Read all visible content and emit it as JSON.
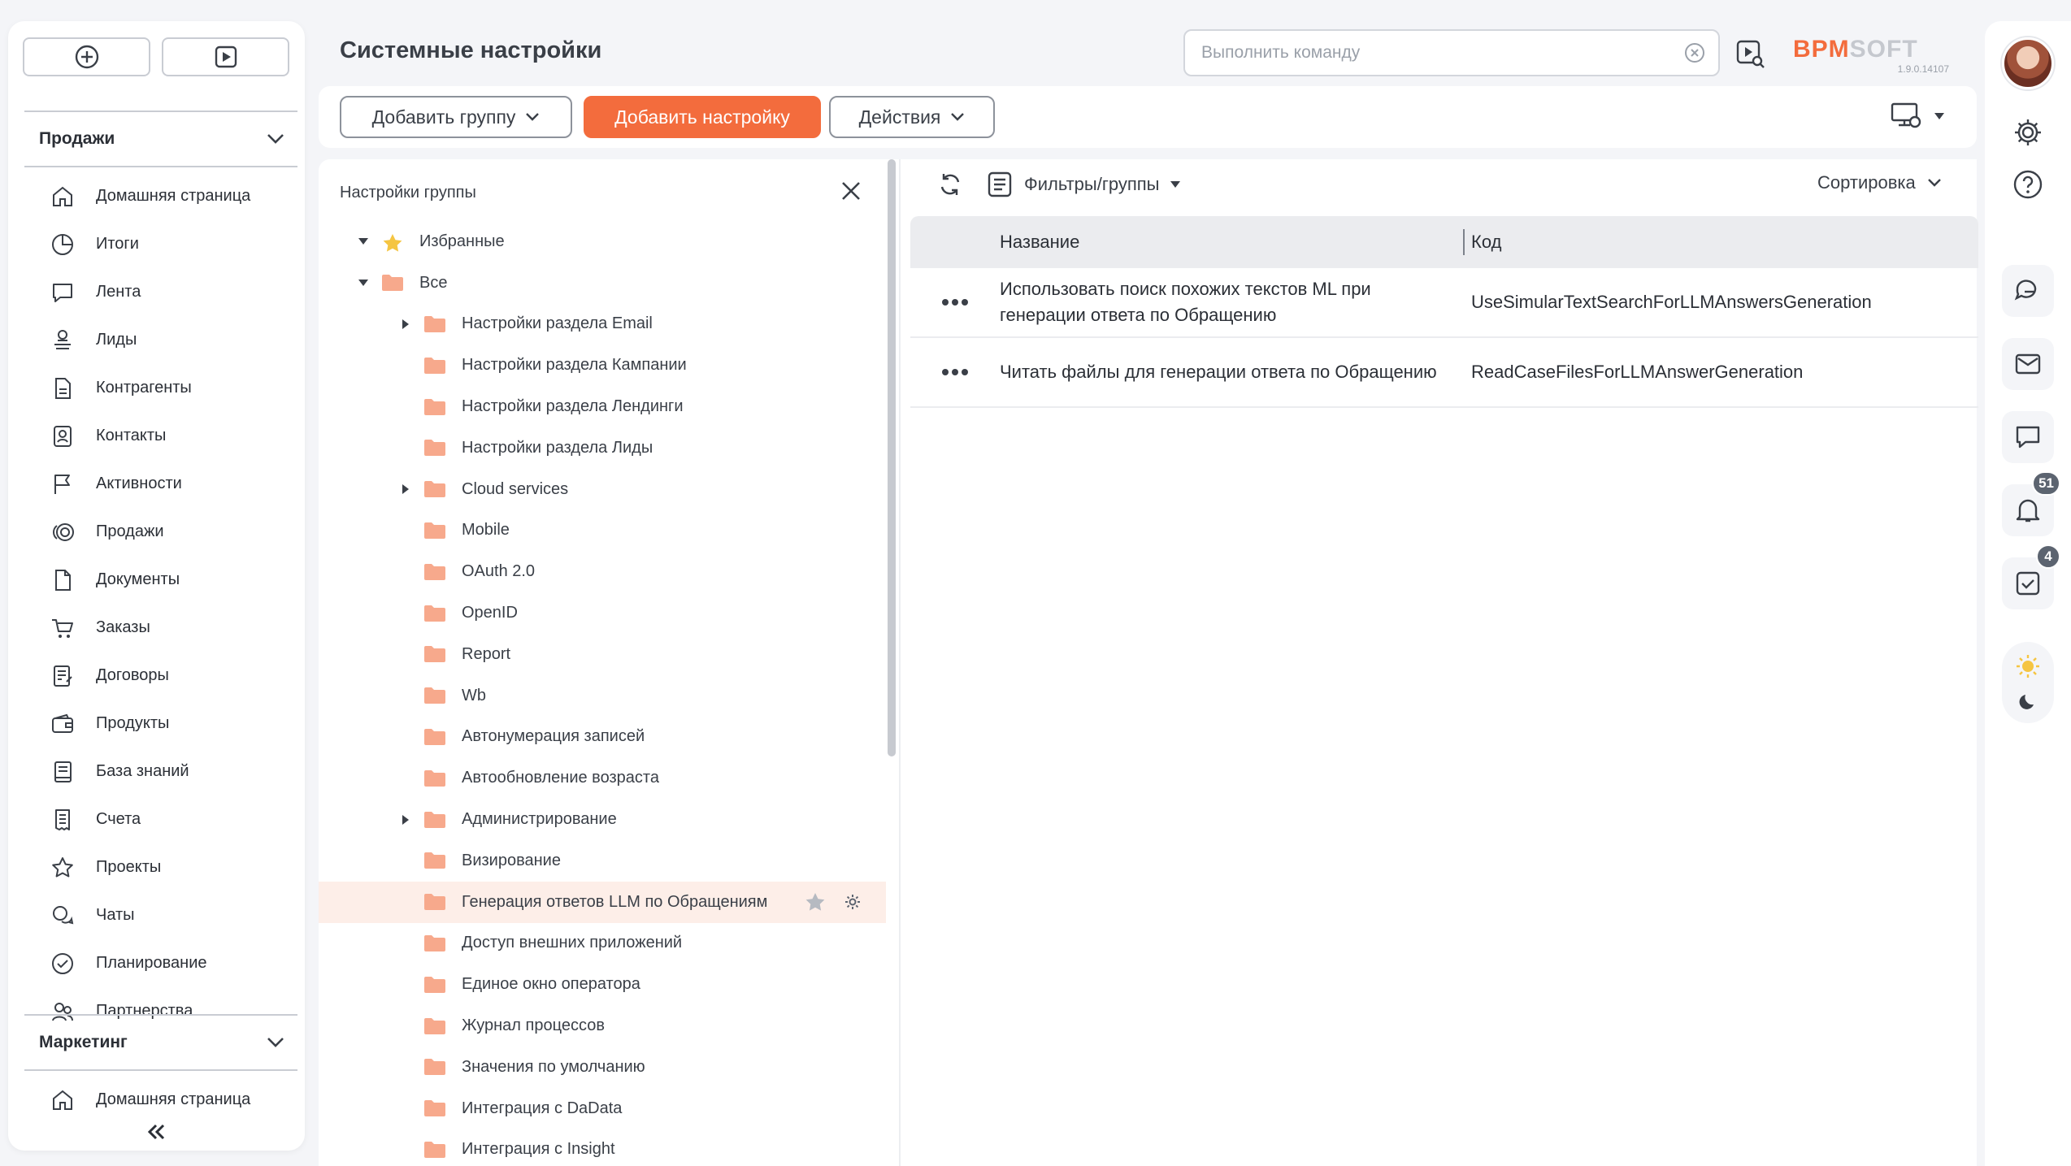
{
  "sidebar": {
    "top_buttons": [
      {
        "icon": "plus-circle-icon"
      },
      {
        "icon": "play-icon"
      }
    ],
    "section_sales": "Продажи",
    "items": [
      {
        "label": "Домашняя страница",
        "icon": "home-icon"
      },
      {
        "label": "Итоги",
        "icon": "pie-chart-icon"
      },
      {
        "label": "Лента",
        "icon": "chat-bubble-icon"
      },
      {
        "label": "Лиды",
        "icon": "lead-icon"
      },
      {
        "label": "Контрагенты",
        "icon": "document-icon"
      },
      {
        "label": "Контакты",
        "icon": "contact-card-icon"
      },
      {
        "label": "Активности",
        "icon": "flag-icon"
      },
      {
        "label": "Продажи",
        "icon": "coins-icon"
      },
      {
        "label": "Документы",
        "icon": "file-icon"
      },
      {
        "label": "Заказы",
        "icon": "cart-icon"
      },
      {
        "label": "Договоры",
        "icon": "contract-icon"
      },
      {
        "label": "Продукты",
        "icon": "wallet-icon"
      },
      {
        "label": "База знаний",
        "icon": "book-icon"
      },
      {
        "label": "Счета",
        "icon": "invoice-icon"
      },
      {
        "label": "Проекты",
        "icon": "star-icon"
      },
      {
        "label": "Чаты",
        "icon": "chats-icon"
      },
      {
        "label": "Планирование",
        "icon": "check-circle-icon"
      },
      {
        "label": "Партнерства",
        "icon": "partners-icon"
      }
    ],
    "section_marketing": "Маркетинг",
    "marketing_items": [
      {
        "label": "Домашняя страница",
        "icon": "home-icon"
      }
    ]
  },
  "header": {
    "title": "Системные настройки",
    "command_placeholder": "Выполнить команду",
    "logo_part1": "BPM",
    "logo_part2": "SOFT",
    "version": "1.9.0.14107"
  },
  "toolbar": {
    "add_group": "Добавить группу",
    "add_setting": "Добавить настройку",
    "actions": "Действия"
  },
  "tree": {
    "title": "Настройки группы",
    "rows": [
      {
        "label": "Избранные",
        "level": 0,
        "expanded": true,
        "icon": "star"
      },
      {
        "label": "Все",
        "level": 0,
        "expanded": true,
        "icon": "folder"
      },
      {
        "label": "Настройки раздела Email",
        "level": 1,
        "collapsed": true,
        "icon": "folder"
      },
      {
        "label": "Настройки раздела Кампании",
        "level": 1,
        "icon": "folder"
      },
      {
        "label": "Настройки раздела Лендинги",
        "level": 1,
        "icon": "folder"
      },
      {
        "label": "Настройки раздела Лиды",
        "level": 1,
        "icon": "folder"
      },
      {
        "label": "Cloud services",
        "level": 1,
        "collapsed": true,
        "icon": "folder"
      },
      {
        "label": "Mobile",
        "level": 1,
        "icon": "folder"
      },
      {
        "label": "OAuth 2.0",
        "level": 1,
        "icon": "folder"
      },
      {
        "label": "OpenID",
        "level": 1,
        "icon": "folder"
      },
      {
        "label": "Report",
        "level": 1,
        "icon": "folder"
      },
      {
        "label": "Wb",
        "level": 1,
        "icon": "folder"
      },
      {
        "label": "Автонумерация записей",
        "level": 1,
        "icon": "folder"
      },
      {
        "label": "Автообновление возраста",
        "level": 1,
        "icon": "folder"
      },
      {
        "label": "Администрирование",
        "level": 1,
        "collapsed": true,
        "icon": "folder"
      },
      {
        "label": "Визирование",
        "level": 1,
        "icon": "folder"
      },
      {
        "label": "Генерация ответов LLM по Обращениям",
        "level": 1,
        "icon": "folder",
        "selected": true
      },
      {
        "label": "Доступ внешних приложений",
        "level": 1,
        "icon": "folder"
      },
      {
        "label": "Единое окно оператора",
        "level": 1,
        "icon": "folder"
      },
      {
        "label": "Журнал процессов",
        "level": 1,
        "icon": "folder"
      },
      {
        "label": "Значения по умолчанию",
        "level": 1,
        "icon": "folder"
      },
      {
        "label": "Интеграция с DaData",
        "level": 1,
        "icon": "folder"
      },
      {
        "label": "Интеграция с Insight",
        "level": 1,
        "icon": "folder"
      }
    ]
  },
  "grid": {
    "filters_label": "Фильтры/группы",
    "sort_label": "Сортировка",
    "columns": [
      "Название",
      "Код"
    ],
    "rows": [
      {
        "name": "Использовать поиск похожих текстов ML при генерации ответа по Обращению",
        "code": "UseSimularTextSearchForLLMAnswersGeneration"
      },
      {
        "name": "Читать файлы для генерации ответа по Обращению",
        "code": "ReadCaseFilesForLLMAnswerGeneration"
      }
    ]
  },
  "rail": {
    "notifications_count": "51",
    "tasks_count": "4"
  },
  "colors": {
    "accent": "#f36c3d",
    "folder": "#f7a98c",
    "star": "#f5c542",
    "selected_row": "#fdeee8"
  }
}
